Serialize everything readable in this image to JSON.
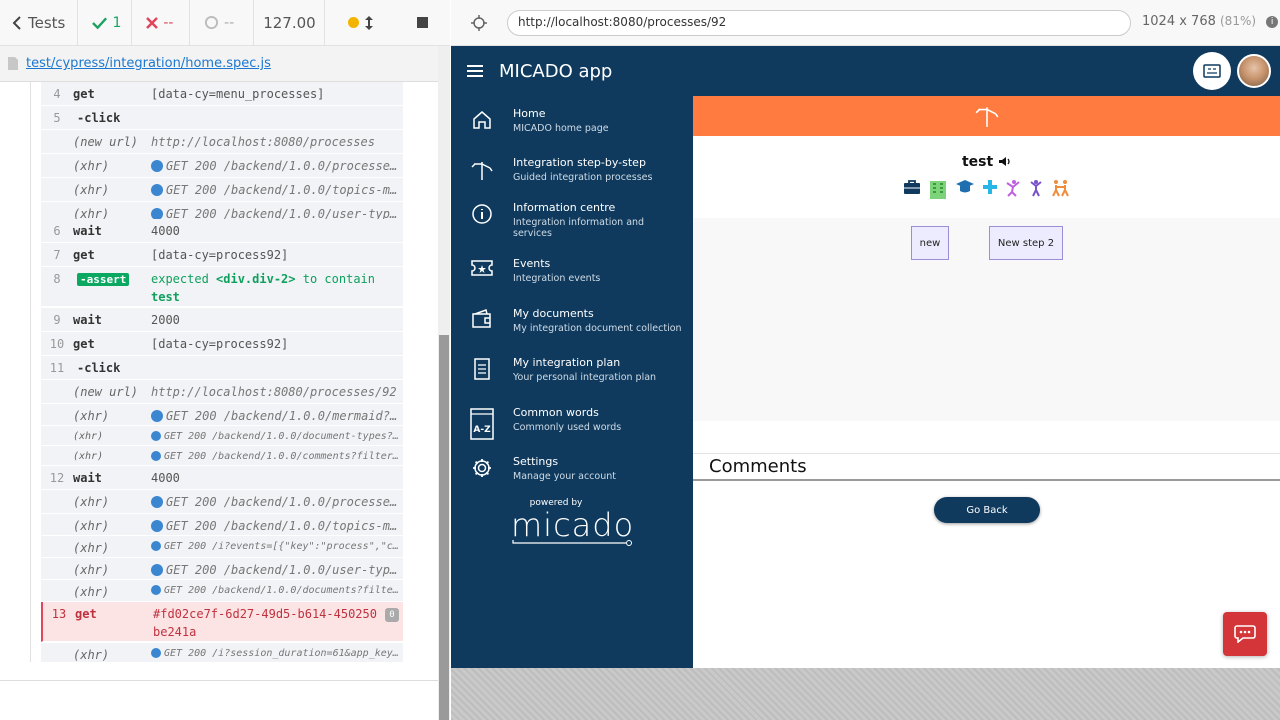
{
  "runner": {
    "tests_label": "Tests",
    "passed": "1",
    "failed": "--",
    "pending": "--",
    "duration": "127.00",
    "spec_path": "test/cypress/integration/home.spec.js"
  },
  "browser": {
    "url": "http://localhost:8080/processes/92",
    "viewport": "1024 x 768",
    "zoom": "(81%)"
  },
  "commands": [
    {
      "num": "4",
      "name": "get",
      "msg": "[data-cy=menu_processes]"
    },
    {
      "num": "5",
      "name": "-click",
      "msg": ""
    },
    {
      "num": "",
      "name": "(new url)",
      "msg": "http://localhost:8080/processes"
    },
    {
      "num": "",
      "name": "(xhr)",
      "msg": "GET 200 /backend/1.0.0/processes?..."
    },
    {
      "num": "",
      "name": "(xhr)",
      "msg": "GET 200 /backend/1.0.0/topics-mi..."
    },
    {
      "num": "",
      "name": "(xhr)",
      "msg": "GET 200 /backend/1.0.0/user-type..."
    },
    {
      "num": "6",
      "name": "wait",
      "msg": "4000"
    },
    {
      "num": "7",
      "name": "get",
      "msg": "[data-cy=process92]"
    },
    {
      "num": "8",
      "name": "assert",
      "msg_prefix": "expected",
      "msg_el": "<div.div-2>",
      "msg_mid": "to contain",
      "msg_val": "test"
    },
    {
      "num": "9",
      "name": "wait",
      "msg": "2000"
    },
    {
      "num": "10",
      "name": "get",
      "msg": "[data-cy=process92]"
    },
    {
      "num": "11",
      "name": "-click",
      "msg": ""
    },
    {
      "num": "",
      "name": "(new url)",
      "msg": "http://localhost:8080/processes/92"
    },
    {
      "num": "",
      "name": "(xhr)",
      "msg": "GET 200 /backend/1.0.0/mermaid?p..."
    },
    {
      "num": "",
      "name": "(xhr)",
      "msg": "GET 200 /backend/1.0.0/document-types?..."
    },
    {
      "num": "",
      "name": "(xhr)",
      "msg": "GET 200 /backend/1.0.0/comments?filter..."
    },
    {
      "num": "12",
      "name": "wait",
      "msg": "4000"
    },
    {
      "num": "",
      "name": "(xhr)",
      "msg": "GET 200 /backend/1.0.0/processes..."
    },
    {
      "num": "",
      "name": "(xhr)",
      "msg": "GET 200 /backend/1.0.0/topics-mi..."
    },
    {
      "num": "",
      "name": "(xhr)",
      "msg": "GET 200 /i?events=[{\"key\":\"process\",\"c..."
    },
    {
      "num": "",
      "name": "(xhr)",
      "msg": "GET 200 /backend/1.0.0/user-type..."
    },
    {
      "num": "",
      "name": "(xhr)",
      "msg": "GET 200 /backend/1.0.0/documents?filte..."
    },
    {
      "num": "13",
      "name": "get",
      "msg": "#fd02ce7f-6d27-49d5-b614-450250be241a",
      "badge": "0"
    },
    {
      "num": "",
      "name": "(xhr)",
      "msg": "GET 200 /i?session_duration=61&app_key..."
    }
  ],
  "app": {
    "title": "MICADO app",
    "nav": [
      {
        "title": "Home",
        "sub": "MICADO home page",
        "icon": "home-icon"
      },
      {
        "title": "Integration step-by-step",
        "sub": "Guided integration processes",
        "icon": "signpost-icon"
      },
      {
        "title": "Information centre",
        "sub": "Integration information and services",
        "icon": "info-icon"
      },
      {
        "title": "Events",
        "sub": "Integration events",
        "icon": "ticket-icon"
      },
      {
        "title": "My documents",
        "sub": "My integration document collection",
        "icon": "wallet-icon"
      },
      {
        "title": "My integration plan",
        "sub": "Your personal integration plan",
        "icon": "document-icon"
      },
      {
        "title": "Common words",
        "sub": "Commonly used words",
        "icon": "glossary-icon"
      },
      {
        "title": "Settings",
        "sub": "Manage your account",
        "icon": "gear-icon"
      }
    ],
    "powered_by": "powered by",
    "brand": "micado",
    "process_title": "test",
    "nodes": [
      "new",
      "New step 2"
    ],
    "comments_heading": "Comments",
    "go_back": "Go Back"
  },
  "colors": {
    "app_navy": "#0f3a5d",
    "orange_band": "#ff7b40",
    "chat_red": "#d43538",
    "assert_green": "#0ba862",
    "error_red": "#c0313f"
  }
}
